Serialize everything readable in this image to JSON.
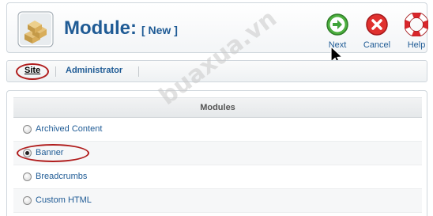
{
  "header": {
    "title": "Module:",
    "subtitle": "[ New ]",
    "icon": "module-boxes-icon"
  },
  "toolbar": {
    "buttons": [
      {
        "label": "Next",
        "icon": "arrow-right-circle-icon",
        "color": "#3fa33a"
      },
      {
        "label": "Cancel",
        "icon": "x-circle-icon",
        "color": "#d8262b"
      },
      {
        "label": "Help",
        "icon": "lifebuoy-icon",
        "color": "#d8262b"
      }
    ]
  },
  "tabs": [
    {
      "label": "Site",
      "active": true
    },
    {
      "label": "Administrator",
      "active": false
    }
  ],
  "modules": {
    "header": "Modules",
    "items": [
      {
        "label": "Archived Content",
        "selected": false
      },
      {
        "label": "Banner",
        "selected": true
      },
      {
        "label": "Breadcrumbs",
        "selected": false
      },
      {
        "label": "Custom HTML",
        "selected": false
      }
    ]
  },
  "watermark": "buaxua.vn",
  "colors": {
    "accent": "#1f5b95",
    "highlight_oval": "#b01c1c"
  }
}
